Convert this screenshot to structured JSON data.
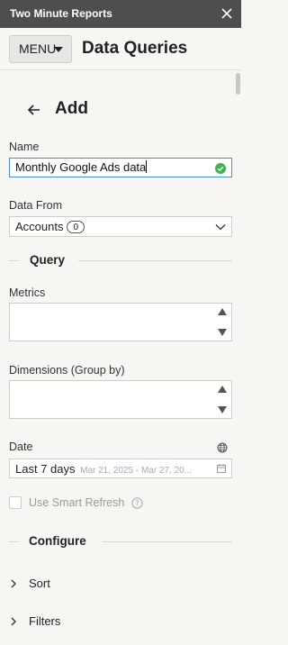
{
  "window": {
    "title": "Two Minute Reports"
  },
  "header": {
    "menu_label": "MENU",
    "page_title": "Data Queries"
  },
  "form": {
    "heading": "Add",
    "name_label": "Name",
    "name_value": "Monthly Google Ads data",
    "data_from_label": "Data From",
    "data_from_value": "Accounts",
    "data_from_count": "0",
    "query_section": "Query",
    "metrics_label": "Metrics",
    "dimensions_label": "Dimensions (Group by)",
    "date_label": "Date",
    "date_preset": "Last 7 days",
    "date_range": "Mar 21, 2025 - Mar 27, 20...",
    "smart_refresh_label": "Use Smart Refresh",
    "smart_refresh_checked": false,
    "configure_section": "Configure",
    "sort_label": "Sort",
    "filters_label": "Filters"
  },
  "colors": {
    "titlebar": "#4e4e4e",
    "focus_border": "#4a90c8",
    "valid_check": "#3cb54a",
    "background": "#f7f6f3"
  },
  "icons": [
    "close-icon",
    "menu-caret-icon",
    "back-arrow-icon",
    "check-circle-icon",
    "chevron-down-icon",
    "globe-icon",
    "calendar-icon",
    "help-icon",
    "chevron-right-icon"
  ]
}
